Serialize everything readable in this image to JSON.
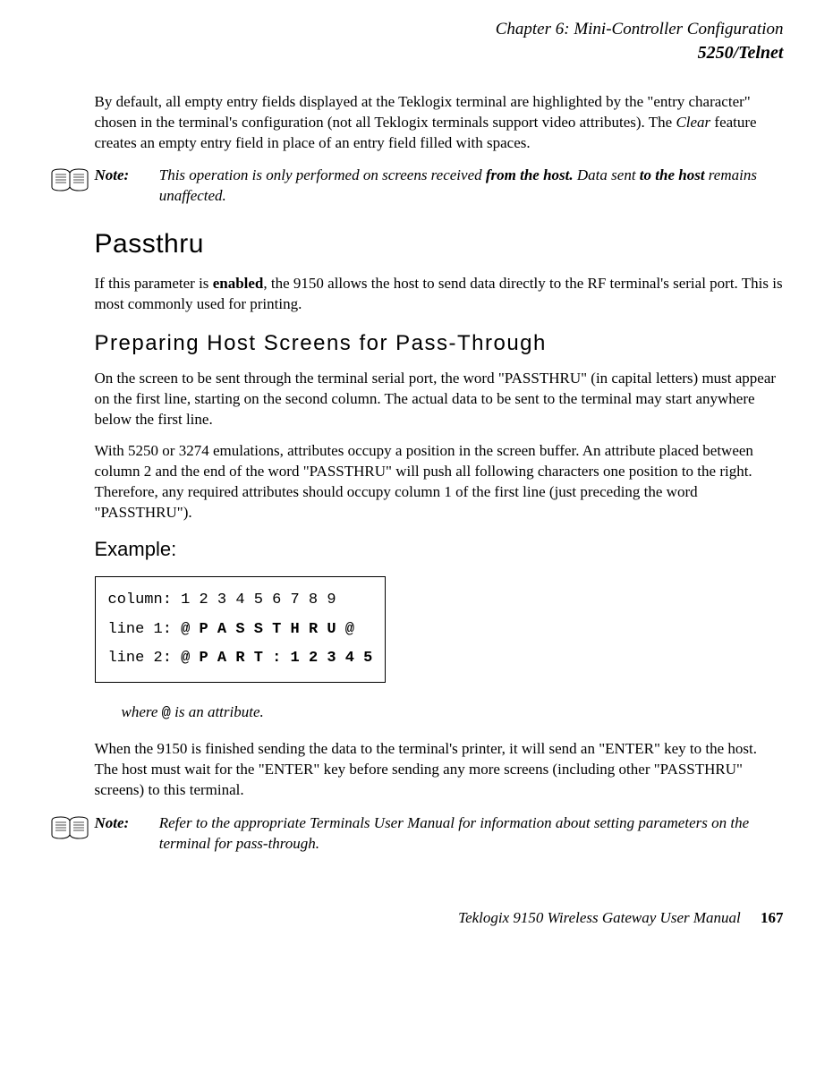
{
  "header": {
    "chapter": "Chapter 6:  Mini-Controller Configuration",
    "section": "5250/Telnet"
  },
  "para1_pre": "By default, all empty entry fields displayed at the Teklogix terminal are highlighted by the \"entry character\" chosen in the terminal's configuration (not all Teklogix terminals support video attributes). The ",
  "para1_em": "Clear",
  "para1_post": " feature creates an empty entry field in place of an entry field filled with spaces.",
  "note1": {
    "label": "Note:",
    "pre": "This operation is only performed on screens received ",
    "b1": "from the host.",
    "mid": " Data sent ",
    "b2": "to the host",
    "post": " remains unaffected."
  },
  "h_passthru": "Passthru",
  "passthru_pre": "If this parameter is ",
  "passthru_b": "enabled",
  "passthru_post": ", the 9150 allows the host to send data directly to the RF terminal's serial port. This is most commonly used for printing.",
  "h_prep": "Preparing Host Screens for Pass-Through",
  "prep_p1": "On the screen to be sent through the terminal serial port, the word \"PASSTHRU\" (in capital letters) must appear on the first line, starting on the second column. The actual data to be sent to the terminal may start anywhere below the first line.",
  "prep_p2": "With 5250 or 3274 emulations, attributes occupy a position in the screen buffer. An attribute placed between column 2 and the end of the word \"PASSTHRU\" will push all following characters one position to the right. Therefore, any required attributes should occupy column 1 of the first line (just preceding the word \"PASSTHRU\").",
  "h_example": "Example:",
  "code": {
    "l1": "column: 1 2 3 4 5 6 7 8 9",
    "l2a": "line 1: ",
    "l2b": "@ P A S S T H R U @",
    "l3a": "line 2: ",
    "l3b": "@ P A R T :   1 2 3 4 5"
  },
  "where_pre": "where ",
  "where_code": "@",
  "where_post": " is an attribute.",
  "after_p": "When the 9150 is finished sending the data to the terminal's printer, it will send an \"ENTER\" key to the host. The host must wait for the \"ENTER\" key before sending any more screens (including other \"PASSTHRU\" screens) to this terminal.",
  "note2": {
    "label": "Note:",
    "text": "Refer to the appropriate Terminals User Manual for information about setting parameters on the terminal for pass-through."
  },
  "footer": {
    "title": "Teklogix 9150 Wireless Gateway User Manual",
    "page": "167"
  }
}
